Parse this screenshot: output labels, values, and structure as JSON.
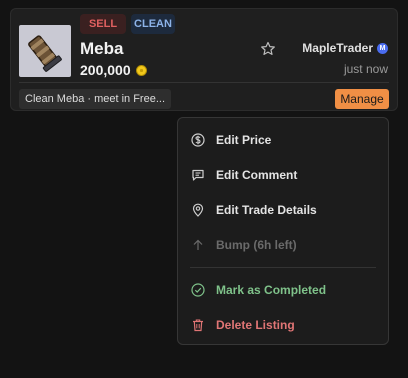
{
  "listing": {
    "type_badge": "SELL",
    "quality_badge": "CLEAN",
    "item_name": "Meba",
    "price": "200,000",
    "seller": "MapleTrader",
    "seller_badge": "M",
    "time": "just now",
    "comment": "Clean Meba · meet in Free...",
    "manage_label": "Manage"
  },
  "menu": {
    "items": [
      {
        "label": "Edit Price",
        "icon": "dollar-circle-icon"
      },
      {
        "label": "Edit Comment",
        "icon": "comment-icon"
      },
      {
        "label": "Edit Trade Details",
        "icon": "location-pin-icon"
      },
      {
        "label": "Bump (6h left)",
        "icon": "arrow-up-icon"
      },
      {
        "label": "Mark as Completed",
        "icon": "check-circle-icon"
      },
      {
        "label": "Delete Listing",
        "icon": "trash-icon"
      }
    ]
  },
  "colors": {
    "sell": "#e06060",
    "clean": "#8db3e8",
    "manage": "#f08f45",
    "completed": "#7fc28a",
    "delete": "#e07575"
  }
}
